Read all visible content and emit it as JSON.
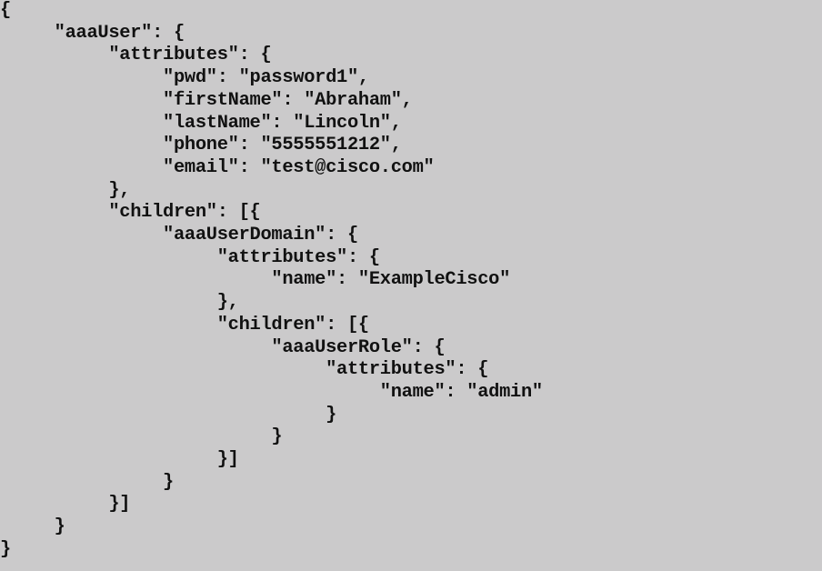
{
  "code_lines": [
    "{",
    "     \"aaaUser\": {",
    "          \"attributes\": {",
    "               \"pwd\": \"password1\",",
    "               \"firstName\": \"Abraham\",",
    "               \"lastName\": \"Lincoln\",",
    "               \"phone\": \"5555551212\",",
    "               \"email\": \"test@cisco.com\"",
    "          },",
    "          \"children\": [{",
    "               \"aaaUserDomain\": {",
    "                    \"attributes\": {",
    "                         \"name\": \"ExampleCisco\"",
    "                    },",
    "                    \"children\": [{",
    "                         \"aaaUserRole\": {",
    "                              \"attributes\": {",
    "                                   \"name\": \"admin\"",
    "                              }",
    "                         }",
    "                    }]",
    "               }",
    "          }]",
    "     }",
    "}"
  ]
}
